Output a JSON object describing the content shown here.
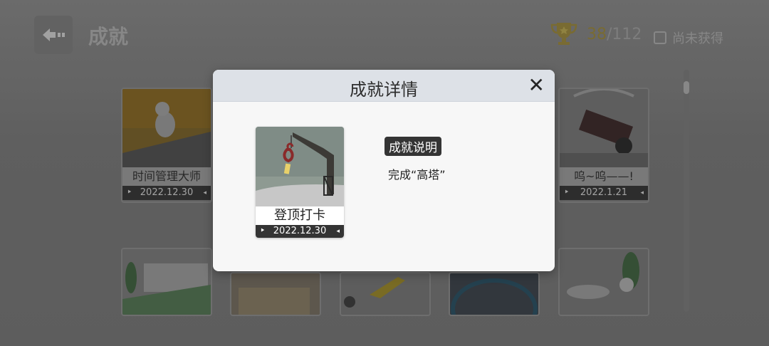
{
  "header": {
    "title": "成就",
    "achieved": "38",
    "total_label": "/112",
    "filter_label": "尚未获得"
  },
  "grid": {
    "items": [
      {
        "label": "时间管理大师",
        "date": "2022.12.30"
      },
      {
        "label": "呜~呜——!",
        "date": "2022.1.21"
      }
    ]
  },
  "modal": {
    "title": "成就详情",
    "close": "✕",
    "achievement": {
      "name": "登顶打卡",
      "date": "2022.12.30"
    },
    "desc_label": "成就说明",
    "desc_text": "完成“高塔”"
  }
}
